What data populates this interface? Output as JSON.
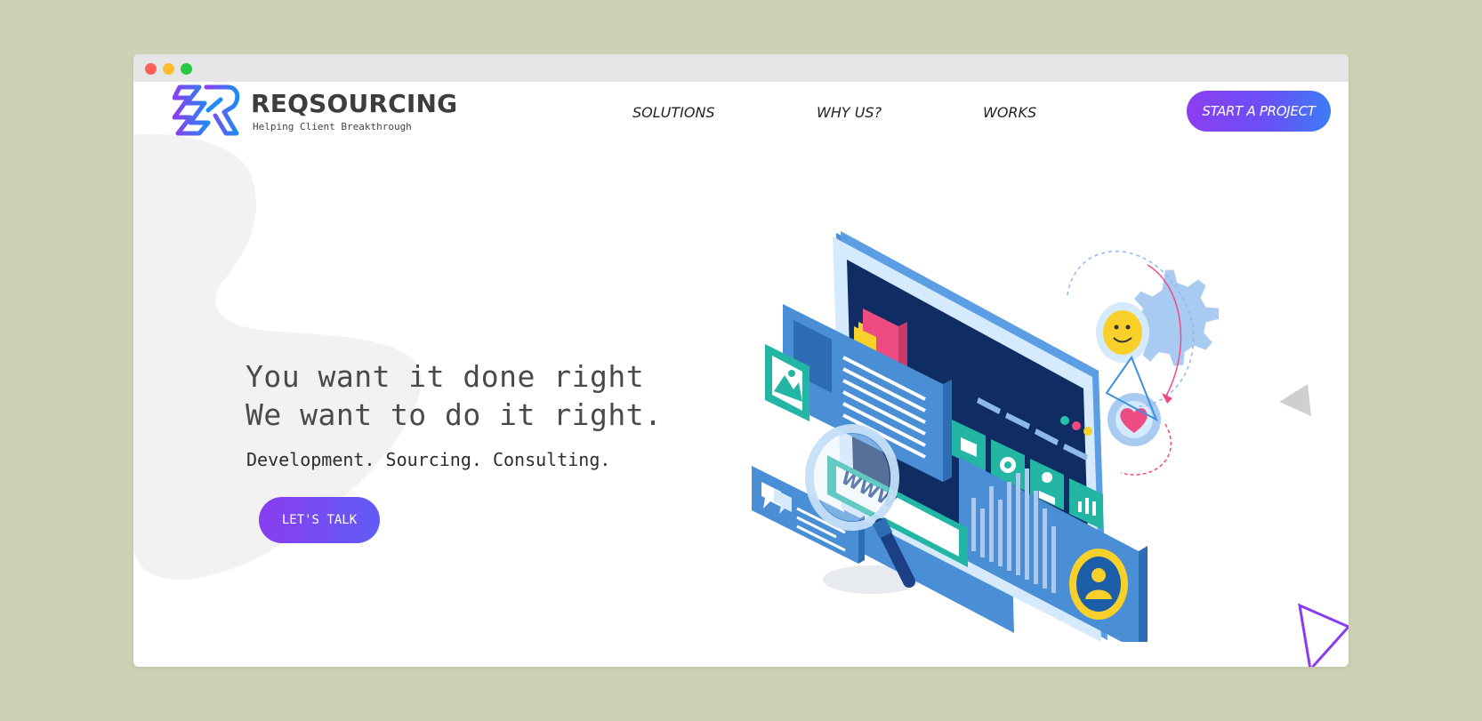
{
  "brand": {
    "name": "REQSOURCING",
    "tagline": "Helping Client Breakthrough"
  },
  "nav": {
    "items": [
      {
        "label": "SOLUTIONS"
      },
      {
        "label": "WHY US?"
      },
      {
        "label": "WORKS"
      }
    ],
    "cta_label": "START A PROJECT"
  },
  "hero": {
    "headline_line1": "You want it done right",
    "headline_line2": "We want to do it right.",
    "subheadline": "Development. Sourcing. Consulting.",
    "cta_label": "LET'S TALK"
  },
  "illustration": {
    "search_text": "WWW",
    "icons": [
      "image-icon",
      "chat-icon",
      "magnifier-icon",
      "gear-icon",
      "user-icon",
      "bar-chart-icon",
      "smiley-icon",
      "heart-icon",
      "email-icon"
    ]
  },
  "colors": {
    "background": "#cfd1b4",
    "accent_purple": "#8b3ef0",
    "accent_blue": "#3d7cf6",
    "text_dark": "#4a4a4a"
  }
}
